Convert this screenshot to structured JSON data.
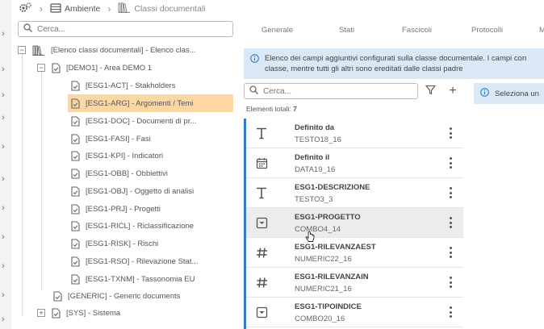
{
  "breadcrumb": {
    "items": [
      {
        "label": "Ambiente"
      },
      {
        "label": "Classi documentali"
      }
    ]
  },
  "tree_search": {
    "placeholder": "Cerca..."
  },
  "tree": {
    "root": {
      "label": "[Elenco classi documentali] - Elenco clas..."
    },
    "demo": {
      "label": "[DEMO1] - Area DEMO 1"
    },
    "children": [
      {
        "label": "[ESG1-ACT] - Stakholders"
      },
      {
        "label": "[ESG1-ARG] - Argomenti / Temi"
      },
      {
        "label": "[ESG1-DOC] - Documenti di pr..."
      },
      {
        "label": "[ESG1-FASI] - Fasi"
      },
      {
        "label": "[ESG1-KPI] - Indicatori"
      },
      {
        "label": "[ESG1-OBB] - Obbiettivi"
      },
      {
        "label": "[ESG1-OBJ] - Oggetto di analisi"
      },
      {
        "label": "[ESG1-PRJ] - Progetti"
      },
      {
        "label": "[ESG1-RICL] - Riclassificazione"
      },
      {
        "label": "[ESG1-RISK] - Rischi"
      },
      {
        "label": "[ESG1-RSO] - Rilevazione Stat..."
      },
      {
        "label": "[ESG1-TXNM] - Tassonomia EU"
      }
    ],
    "generic": {
      "label": "[GENERIC] - Generic documents"
    },
    "sys": {
      "label": "[SYS] - Sistema"
    }
  },
  "tabs": [
    {
      "label": "Generale"
    },
    {
      "label": "Stati"
    },
    {
      "label": "Fascicoli"
    },
    {
      "label": "Protocolli"
    },
    {
      "label": "M"
    }
  ],
  "info_banner": {
    "line1": "Elenco dei campi aggiuntivi configurati sulla classe documentale. I campi con",
    "line2": "classe, mentre tutti gli altri sono ereditati dalle classi padre"
  },
  "list_search": {
    "placeholder": "Cerca..."
  },
  "right_banner": {
    "text": "Seleziona un"
  },
  "total": {
    "label": "Elementi totali:",
    "count": "7"
  },
  "fields": [
    {
      "name": "Definito da",
      "code": "TESTO18_16",
      "icon": "text-icon"
    },
    {
      "name": "Definito il",
      "code": "DATA19_16",
      "icon": "calendar-icon"
    },
    {
      "name": "ESG1-DESCRIZIONE",
      "code": "TESTO3_3",
      "icon": "text-icon"
    },
    {
      "name": "ESG1-PROGETTO",
      "code": "COMBO4_14",
      "icon": "dropdown-icon"
    },
    {
      "name": "ESG1-RILEVANZAEST",
      "code": "NUMERIC22_16",
      "icon": "number-icon"
    },
    {
      "name": "ESG1-RILEVANZAIN",
      "code": "NUMERIC21_16",
      "icon": "number-icon"
    },
    {
      "name": "ESG1-TIPOINDICE",
      "code": "COMBO20_16",
      "icon": "dropdown-icon"
    }
  ],
  "colors": {
    "accent": "#2f7fd0",
    "selected_row": "#fbd7a4",
    "info_background": "#dbe9f6"
  }
}
